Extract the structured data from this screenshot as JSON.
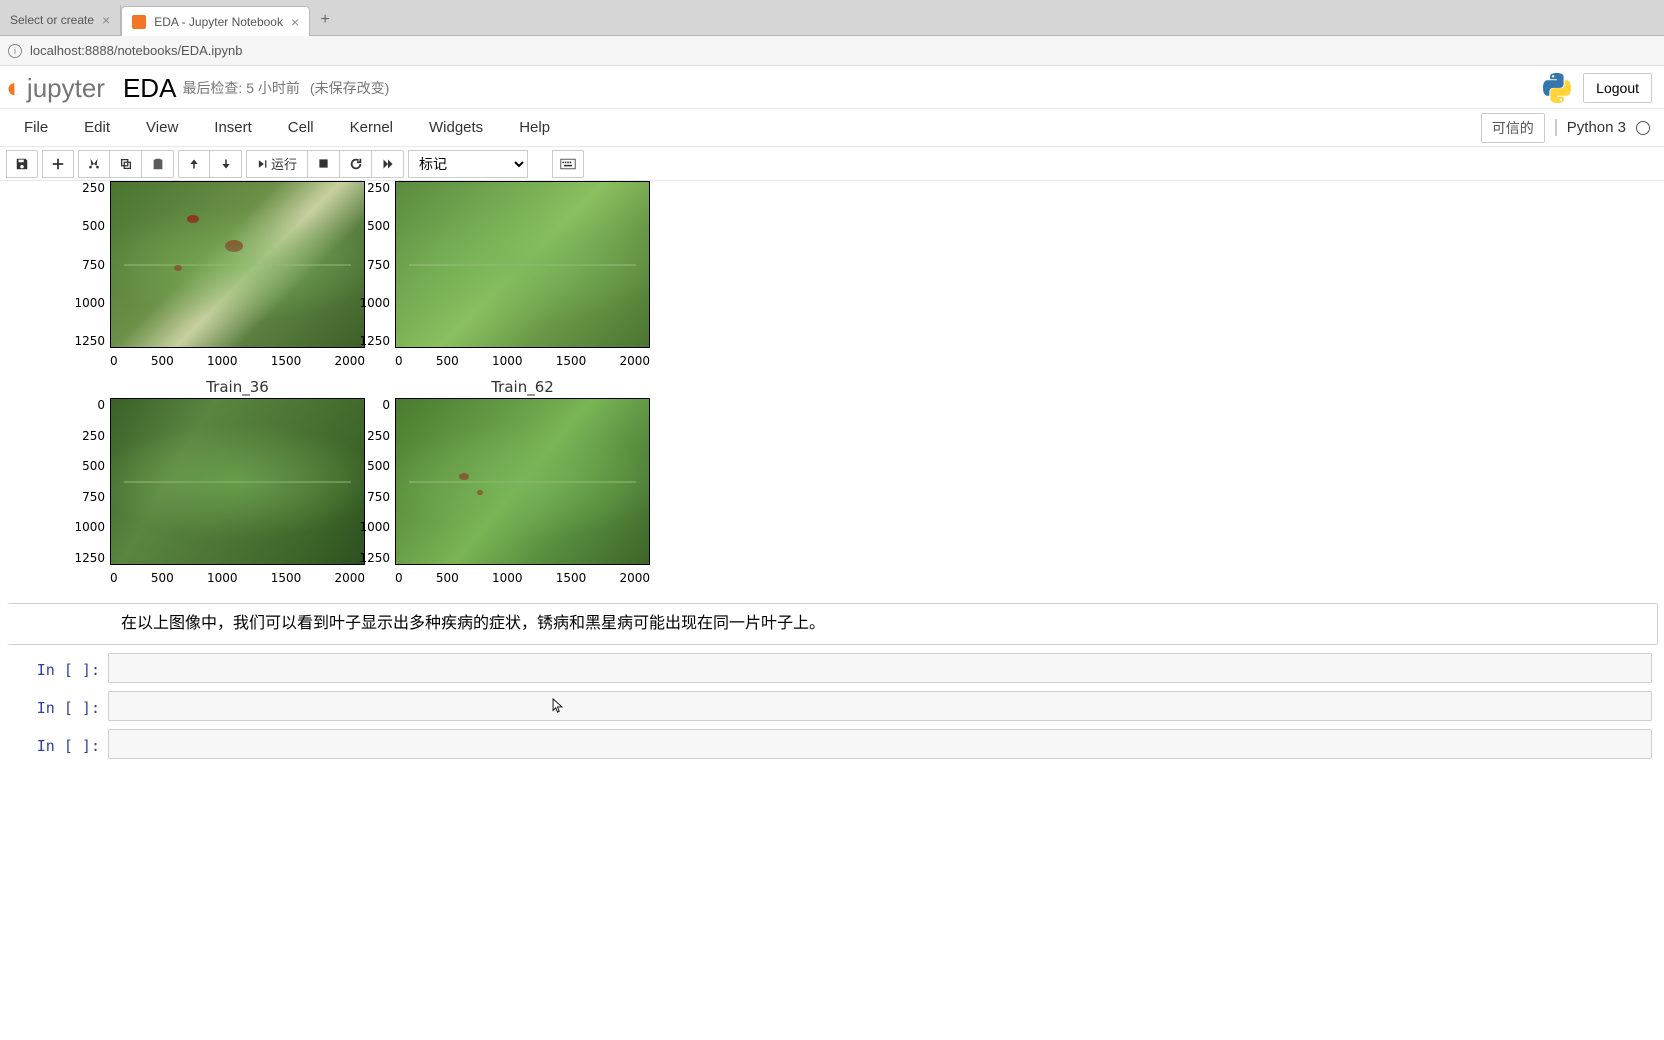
{
  "browser": {
    "tabs": [
      {
        "title": "Select or create"
      },
      {
        "title": "EDA - Jupyter Notebook"
      }
    ],
    "url": "localhost:8888/notebooks/EDA.ipynb"
  },
  "header": {
    "logo_text": "jupyter",
    "notebook_name": "EDA",
    "checkpoint": "最后检查: 5 小时前",
    "unsaved": "(未保存改变)",
    "logout": "Logout"
  },
  "menu": {
    "items": [
      "File",
      "Edit",
      "View",
      "Insert",
      "Cell",
      "Kernel",
      "Widgets",
      "Help"
    ],
    "trusted": "可信的",
    "kernel": "Python 3"
  },
  "toolbar": {
    "run_label": "运行",
    "cell_type": "标记"
  },
  "output": {
    "plots": {
      "row1": {
        "left": {
          "y_ticks": [
            "250",
            "500",
            "750",
            "1000",
            "1250"
          ],
          "x_ticks": [
            "0",
            "500",
            "1000",
            "1500",
            "2000"
          ]
        },
        "right": {
          "y_ticks": [
            "250",
            "500",
            "750",
            "1000",
            "1250"
          ],
          "x_ticks": [
            "0",
            "500",
            "1000",
            "1500",
            "2000"
          ]
        }
      },
      "row2": {
        "left": {
          "title": "Train_36",
          "y_ticks": [
            "0",
            "250",
            "500",
            "750",
            "1000",
            "1250"
          ],
          "x_ticks": [
            "0",
            "500",
            "1000",
            "1500",
            "2000"
          ]
        },
        "right": {
          "title": "Train_62",
          "y_ticks": [
            "0",
            "250",
            "500",
            "750",
            "1000",
            "1250"
          ],
          "x_ticks": [
            "0",
            "500",
            "1000",
            "1500",
            "2000"
          ]
        }
      }
    }
  },
  "markdown": {
    "text": "在以上图像中，我们可以看到叶子显示出多种疾病的症状，锈病和黑星病可能出现在同一片叶子上。"
  },
  "code_cells": {
    "prompt": "In [ ]:"
  },
  "chart_data": [
    {
      "type": "image",
      "title": "",
      "xlim": [
        0,
        2000
      ],
      "ylim": [
        0,
        1365
      ],
      "x_ticks": [
        0,
        500,
        1000,
        1500,
        2000
      ],
      "y_ticks": [
        250,
        500,
        750,
        1000,
        1250
      ],
      "description": "Apple leaf with rust/scab lesions (top-left, partially scrolled)"
    },
    {
      "type": "image",
      "title": "",
      "xlim": [
        0,
        2000
      ],
      "ylim": [
        0,
        1365
      ],
      "x_ticks": [
        0,
        500,
        1000,
        1500,
        2000
      ],
      "y_ticks": [
        250,
        500,
        750,
        1000,
        1250
      ],
      "description": "Apple leaf healthy/mild (top-right, partially scrolled)"
    },
    {
      "type": "image",
      "title": "Train_36",
      "xlim": [
        0,
        2000
      ],
      "ylim": [
        0,
        1365
      ],
      "x_ticks": [
        0,
        500,
        1000,
        1500,
        2000
      ],
      "y_ticks": [
        0,
        250,
        500,
        750,
        1000,
        1250
      ],
      "description": "Apple leaf Train_36"
    },
    {
      "type": "image",
      "title": "Train_62",
      "xlim": [
        0,
        2000
      ],
      "ylim": [
        0,
        1365
      ],
      "x_ticks": [
        0,
        500,
        1000,
        1500,
        2000
      ],
      "y_ticks": [
        0,
        250,
        500,
        750,
        1000,
        1250
      ],
      "description": "Apple leaf Train_62 with spots"
    }
  ]
}
